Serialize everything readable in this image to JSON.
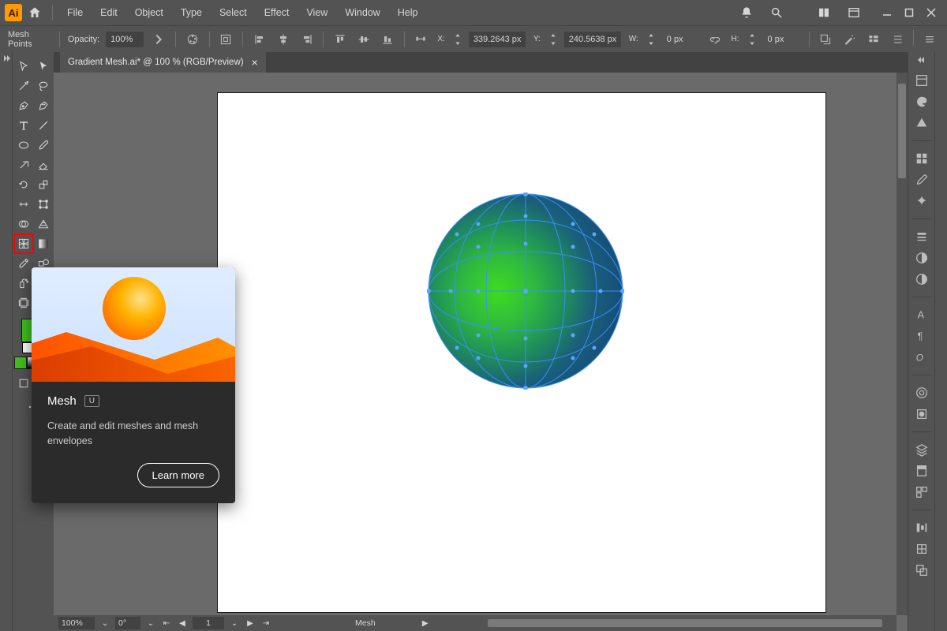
{
  "menu": {
    "items": [
      "File",
      "Edit",
      "Object",
      "Type",
      "Select",
      "Effect",
      "View",
      "Window",
      "Help"
    ]
  },
  "control": {
    "mode": "Mesh Points",
    "opacity_label": "Opacity:",
    "opacity_value": "100%",
    "x_label": "X:",
    "x_value": "339.2643 px",
    "y_label": "Y:",
    "y_value": "240.5638 px",
    "w_label": "W:",
    "w_value": "0 px",
    "h_label": "H:",
    "h_value": "0 px"
  },
  "document": {
    "tab_title": "Gradient Mesh.ai* @ 100 % (RGB/Preview)",
    "zoom": "100%",
    "rotate": "0°",
    "artboard_nav": "1",
    "selection_tool": "Mesh"
  },
  "tooltip": {
    "title": "Mesh",
    "shortcut": "U",
    "description": "Create and edit meshes and mesh envelopes",
    "learn_more": "Learn more"
  },
  "colors": {
    "fill": "#3fbf1f"
  }
}
